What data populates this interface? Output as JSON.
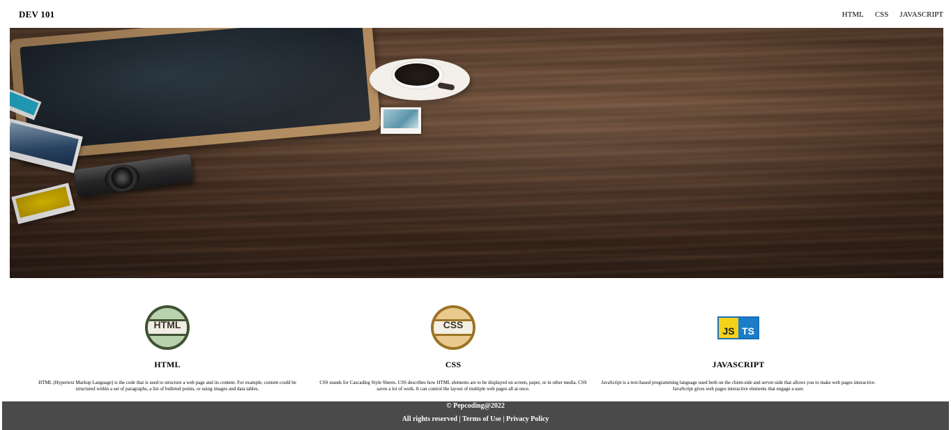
{
  "header": {
    "brand": "DEV 101",
    "nav": [
      "HTML",
      "CSS",
      "JAVASCRIPT"
    ]
  },
  "hero": {
    "image": "wooden-desk-with-chalkboard-coffee-camera-photos"
  },
  "features": [
    {
      "icon": "html-badge-icon",
      "icon_text": "HTML",
      "title": "HTML",
      "description": "HTML (Hypertext Markup Language) is the code that is used to structure a web page and its content. For example, content could be structured within a set of paragraphs, a list of bulleted points, or using images and data tables."
    },
    {
      "icon": "css-badge-icon",
      "icon_text": "CSS",
      "title": "CSS",
      "description": "CSS stands for Cascading Style Sheets. CSS describes how HTML elements are to be displayed on screen, paper, or in other media. CSS saves a lot of work. It can control the layout of multiple web pages all at once."
    },
    {
      "icon": "js-ts-badge-icon",
      "icon_text_js": "JS",
      "icon_text_ts": "TS",
      "title": "JAVASCRIPT",
      "description": "JavaScript is a text-based programming language used both on the client-side and server-side that allows you to make web pages interactive. JavaScript gives web pages interactive elements that engage a user."
    }
  ],
  "footer": {
    "copyright": "© Pepcoding@2022",
    "rights": "All rights reserved",
    "separator": "|",
    "terms": "Terms of Use",
    "privacy": "Privacy Policy",
    "background": "#4a4a4a"
  }
}
